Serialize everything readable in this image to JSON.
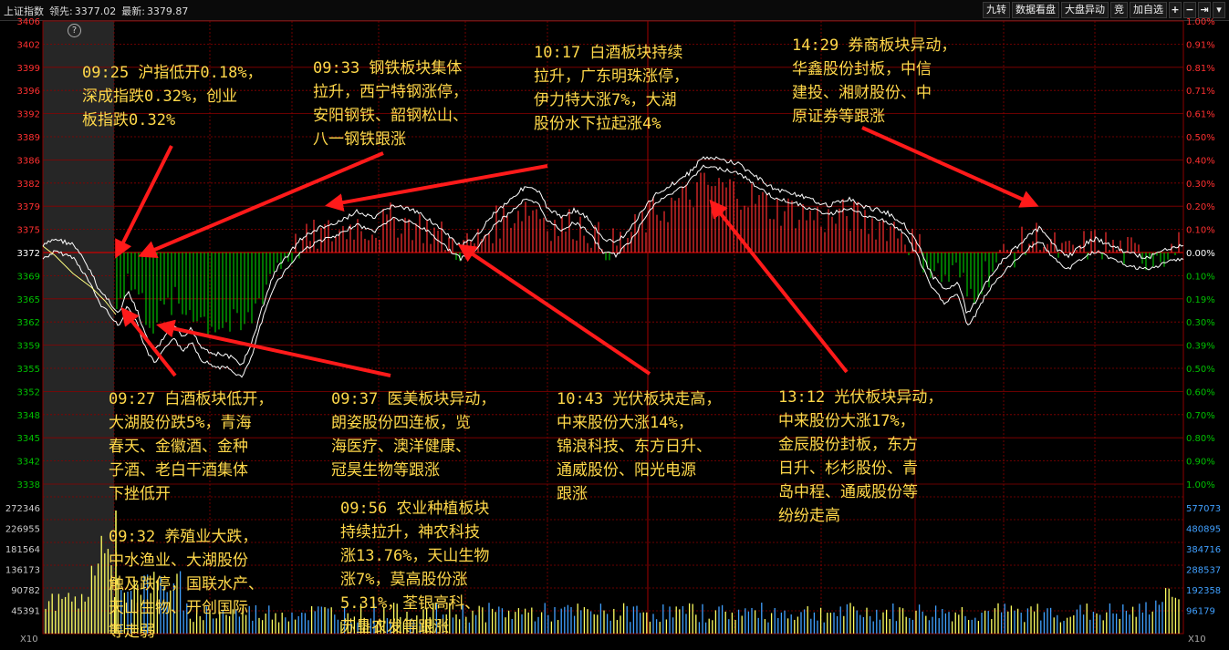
{
  "header": {
    "index_name": "上证指数",
    "lead_label": "领先:",
    "lead_value": "3377.02",
    "latest_label": "最新:",
    "latest_value": "3379.87",
    "buttons": [
      "九转",
      "数据看盘",
      "大盘异动",
      "竞",
      "加自选"
    ],
    "icon_buttons": [
      "plus-icon",
      "minus-icon",
      "collapse-icon",
      "dropdown-icon"
    ]
  },
  "axes": {
    "left_price_ticks": [
      "3406",
      "3402",
      "3399",
      "3396",
      "3392",
      "3389",
      "3386",
      "3382",
      "3379",
      "3375",
      "3372",
      "3369",
      "3365",
      "3362",
      "3359",
      "3355",
      "3352",
      "3348",
      "3345",
      "3342",
      "3338"
    ],
    "right_pct_ticks": [
      "1.00%",
      "0.91%",
      "0.81%",
      "0.71%",
      "0.61%",
      "0.50%",
      "0.40%",
      "0.30%",
      "0.20%",
      "0.10%",
      "0.00%",
      "0.10%",
      "0.19%",
      "0.30%",
      "0.39%",
      "0.50%",
      "0.60%",
      "0.70%",
      "0.80%",
      "0.90%",
      "1.00%"
    ],
    "left_volume_ticks": [
      "272346",
      "226955",
      "181564",
      "136173",
      "90782",
      "45391"
    ],
    "right_volume_ticks": [
      "577073",
      "480895",
      "384716",
      "288537",
      "192358",
      "96179"
    ],
    "volume_scale_left": "X10",
    "volume_scale_right": "X10",
    "help_symbol": "?"
  },
  "colors": {
    "background": "#000000",
    "grid_red": "#8b0000",
    "up": "#ff3030",
    "down": "#00c000",
    "flat": "#ffffff",
    "index_line": "#ffffff",
    "avg_line": "#ffff80",
    "annotation": "#ffd84a",
    "arrow": "#ff1a1a",
    "volume_bar": "#ffff60",
    "volume_bar_alt": "#40a0ff"
  },
  "annotations": [
    {
      "id": "0925",
      "text": "09:25 沪指低开0.18%，\n深成指跌0.32%，创业\n板指跌0.32%"
    },
    {
      "id": "0933",
      "text": "09:33 钢铁板块集体\n拉升，西宁特钢涨停，\n安阳钢铁、韶钢松山、\n八一钢铁跟涨"
    },
    {
      "id": "1017",
      "text": "10:17 白酒板块持续\n拉升，广东明珠涨停，\n伊力特大涨7%，大湖\n股份水下拉起涨4%"
    },
    {
      "id": "1429",
      "text": "14:29 券商板块异动，\n华鑫股份封板，中信\n建投、湘财股份、中\n原证券等跟涨"
    },
    {
      "id": "0927",
      "text": "09:27 白酒板块低开，\n大湖股份跌5%，青海\n春天、金徽酒、金种\n子酒、老白干酒集体\n下挫低开"
    },
    {
      "id": "0937",
      "text": "09:37 医美板块异动，\n朗姿股份四连板，览\n海医疗、澳洋健康、\n冠昊生物等跟涨"
    },
    {
      "id": "1043",
      "text": "10:43 光伏板块走高，\n中来股份大涨14%，\n锦浪科技、东方日升、\n通威股份、阳光电源\n跟涨"
    },
    {
      "id": "1312",
      "text": "13:12 光伏板块异动，\n中来股份大涨17%，\n金辰股份封板，东方\n日升、杉杉股份、青\n岛中程、通威股份等\n纷纷走高"
    },
    {
      "id": "0932",
      "text": "09:32 养殖业大跌，\n中水渔业、大湖股份\n触及跌停，国联水产、\n天山生物、开创国际\n等走弱"
    },
    {
      "id": "0956",
      "text": "09:56 农业种植板块\n持续拉升，神农科技\n涨13.76%，天山生物\n涨7%，莫高股份涨\n5.31%，荃银高科、\n苏垦农发等跟涨"
    }
  ]
}
